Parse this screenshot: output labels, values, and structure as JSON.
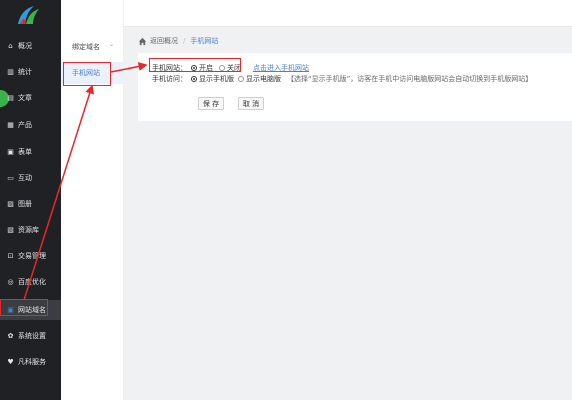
{
  "sidebar": {
    "items": [
      {
        "label": "概况",
        "icon": "home-icon"
      },
      {
        "label": "统计",
        "icon": "stats-icon"
      },
      {
        "label": "文章",
        "icon": "article-icon"
      },
      {
        "label": "产品",
        "icon": "grid-icon"
      },
      {
        "label": "表单",
        "icon": "form-icon"
      },
      {
        "label": "互动",
        "icon": "chat-icon"
      },
      {
        "label": "图册",
        "icon": "image-icon"
      },
      {
        "label": "资源库",
        "icon": "library-icon"
      },
      {
        "label": "交易管理",
        "icon": "trade-icon"
      },
      {
        "label": "百度优化",
        "icon": "seo-icon"
      },
      {
        "label": "网站域名",
        "icon": "domain-icon"
      },
      {
        "label": "系统设置",
        "icon": "gear-icon"
      },
      {
        "label": "凡科服务",
        "icon": "heart-icon"
      }
    ]
  },
  "submenu": {
    "head_label": "绑定域名",
    "chevron": "⌄",
    "item_label": "手机网站"
  },
  "breadcrumb": {
    "back": "返回概况",
    "sep": "/",
    "current": "手机网站"
  },
  "form": {
    "row1_label": "手机网站：",
    "row1_opt_on": "开启",
    "row1_opt_off": "关闭",
    "row1_link": "点击进入手机网站",
    "row2_label": "手机访问：",
    "row2_opt_mobile": "显示手机版",
    "row2_opt_pc": "显示电脑版",
    "row2_hint": "【选择“显示手机版”，访客在手机中访问电脑版网站会自动切换到手机版网站】",
    "save": "保 存",
    "cancel": "取 消"
  },
  "colors": {
    "sidebar_bg": "#1f2124",
    "accent": "#4a7fd1",
    "highlight": "#e8262b"
  }
}
